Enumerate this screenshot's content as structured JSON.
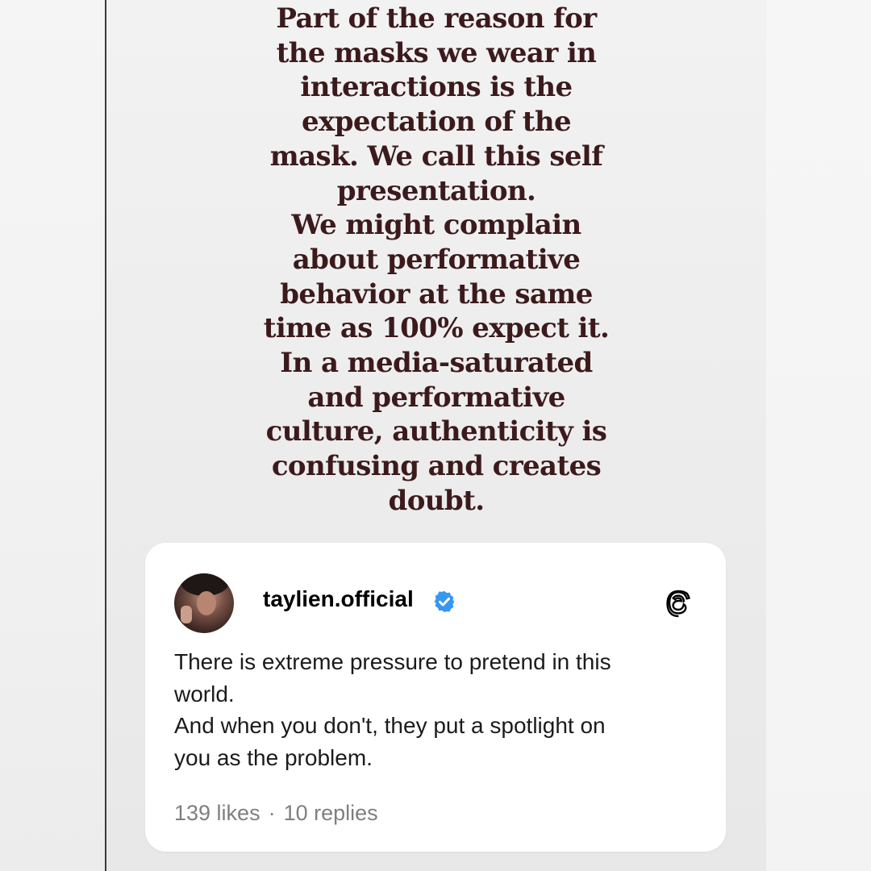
{
  "quote": {
    "lines": [
      "Part of the reason for",
      "the masks we wear in",
      "interactions is the",
      "expectation of the",
      "mask. We call this self",
      "presentation.",
      "We might complain",
      "about performative",
      "behavior at the same",
      "time as 100%  expect it.",
      "In a media-saturated",
      "and performative",
      "culture, authenticity is",
      "confusing and creates",
      "doubt."
    ],
    "color": "#3c1a1c"
  },
  "post": {
    "username": "taylien.official",
    "verified_icon": "verified-badge-icon",
    "platform_icon": "threads-icon",
    "text_lines": [
      "There is extreme pressure to pretend in this",
      "world.",
      "And when you don't, they put a spotlight on",
      "you as the problem."
    ],
    "likes": "139 likes",
    "separator": "·",
    "replies": "10 replies",
    "verified_color": "#3897f0"
  }
}
